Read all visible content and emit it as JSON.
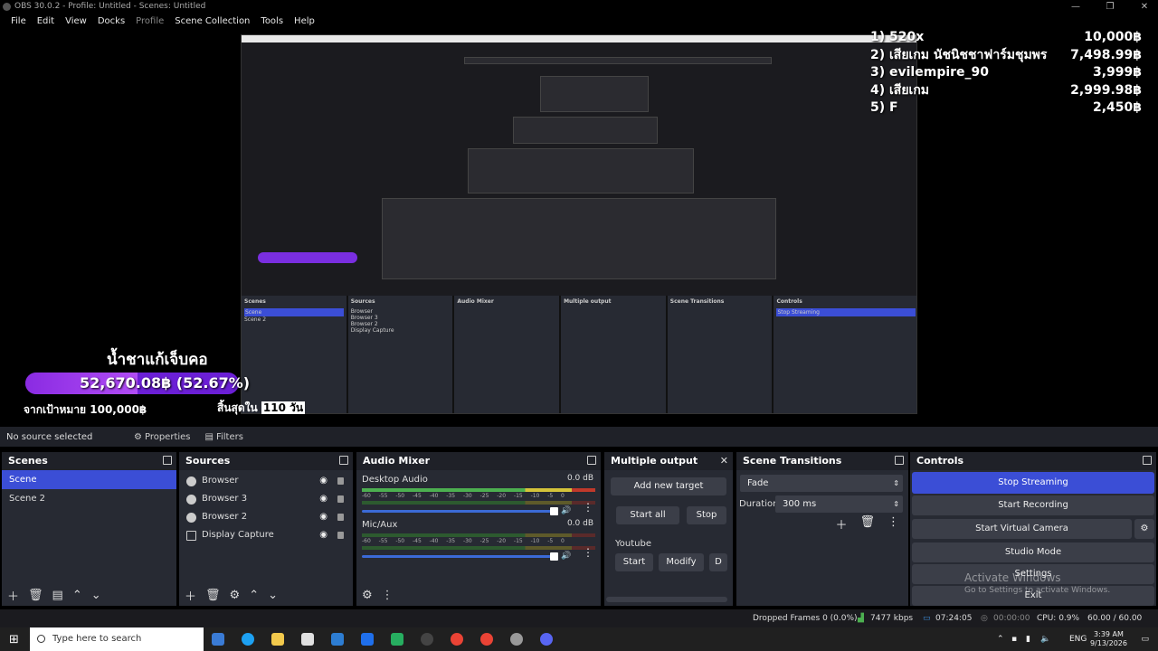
{
  "window": {
    "title": "OBS 30.0.2 - Profile: Untitled - Scenes: Untitled"
  },
  "menu": {
    "file": "File",
    "edit": "Edit",
    "view": "View",
    "docks": "Docks",
    "profile": "Profile",
    "scene_collection": "Scene Collection",
    "tools": "Tools",
    "help": "Help"
  },
  "leaderboard": [
    {
      "name": "1) 520x",
      "amount": "10,000฿"
    },
    {
      "name": "2) เสียเกม นัชนิชชาฟาร์มชุมพร",
      "amount": "7,498.99฿"
    },
    {
      "name": "3) evilempire_90",
      "amount": "3,999฿"
    },
    {
      "name": "4) เสียเกม",
      "amount": "2,999.98฿"
    },
    {
      "name": "5) F",
      "amount": "2,450฿"
    }
  ],
  "goal": {
    "title": "น้ำชาแก้เจ็บคอ",
    "amount": "52,670.08฿ (52.67%)",
    "progress": 0.5267,
    "target": "จากเป้าหมาย 100,000฿",
    "ends": "สิ้นสุดใน",
    "days": "110 วัน"
  },
  "source_bar": {
    "no_selection": "No source selected",
    "properties": "Properties",
    "filters": "Filters"
  },
  "scenes": {
    "title": "Scenes",
    "items": [
      "Scene",
      "Scene 2"
    ]
  },
  "sources": {
    "title": "Sources",
    "items": [
      "Browser",
      "Browser 3",
      "Browser 2",
      "Display Capture"
    ]
  },
  "audio_mixer": {
    "title": "Audio Mixer",
    "ticks": [
      "-60",
      "-55",
      "-50",
      "-45",
      "-40",
      "-35",
      "-30",
      "-25",
      "-20",
      "-15",
      "-10",
      "-5",
      "0"
    ],
    "channels": [
      {
        "name": "Desktop Audio",
        "db": "0.0 dB"
      },
      {
        "name": "Mic/Aux",
        "db": "0.0 dB"
      }
    ]
  },
  "multiple_output": {
    "title": "Multiple output",
    "add_target": "Add new target",
    "start_all": "Start all",
    "stop_all": "Stop",
    "target_name": "Youtube",
    "start": "Start",
    "modify": "Modify",
    "delete": "D"
  },
  "scene_transitions": {
    "title": "Scene Transitions",
    "transition": "Fade",
    "duration_label": "Duration",
    "duration": "300 ms"
  },
  "controls": {
    "title": "Controls",
    "stop_streaming": "Stop Streaming",
    "start_recording": "Start Recording",
    "start_virtual_camera": "Start Virtual Camera",
    "studio_mode": "Studio Mode",
    "settings": "Settings",
    "exit": "Exit"
  },
  "activate": {
    "line1": "Activate Windows",
    "line2": "Go to Settings to activate Windows."
  },
  "status": {
    "dropped": "Dropped Frames 0 (0.0%)",
    "bitrate": "7477 kbps",
    "stream_time": "07:24:05",
    "rec_time": "00:00:00",
    "cpu": "CPU: 0.9%",
    "fps": "60.00 / 60.00 FPS"
  },
  "taskbar": {
    "search_placeholder": "Type here to search",
    "lang": "ENG",
    "time": "3:39 AM",
    "date": "9/13/2026"
  },
  "colors": {
    "accent": "#3b4ed6",
    "goal_bar": "#8a2be2",
    "dock_bg": "#272a33"
  }
}
